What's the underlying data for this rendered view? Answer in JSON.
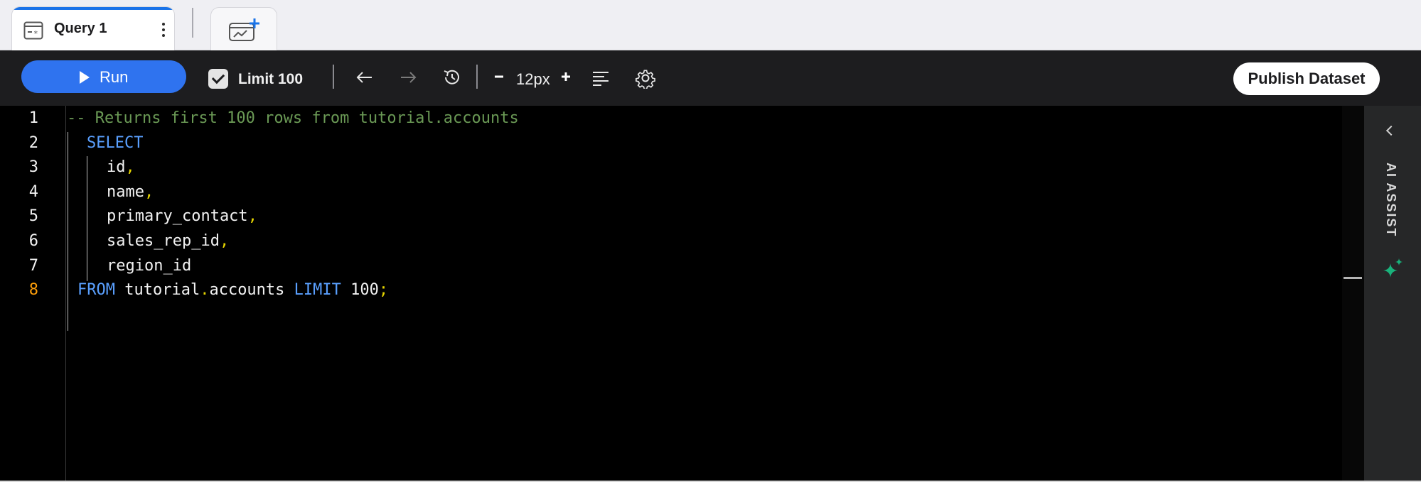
{
  "tabs": {
    "active_label": "Query 1",
    "active_icon": "query-window-icon",
    "new_tab_icon": "new-chart-tab-icon"
  },
  "toolbar": {
    "run_label": "Run",
    "limit_label": "Limit 100",
    "limit_checked": true,
    "font_size": "12px",
    "publish_label": "Publish Dataset",
    "icons": [
      "undo-arrow-icon",
      "redo-arrow-icon",
      "history-icon",
      "minus-icon",
      "plus-icon",
      "format-lines-icon",
      "gear-icon"
    ]
  },
  "editor": {
    "line_numbers": [
      "1",
      "2",
      "3",
      "4",
      "5",
      "6",
      "7",
      "8"
    ],
    "active_line": "8",
    "lines": [
      [
        {
          "t": "-- Returns first 100 rows from tutorial.accounts",
          "k": "comment"
        }
      ],
      [
        {
          "t": "SELECT",
          "k": "kw"
        }
      ],
      [
        {
          "t": "id",
          "k": "id"
        },
        {
          "t": ",",
          "k": "punct"
        }
      ],
      [
        {
          "t": "name",
          "k": "id"
        },
        {
          "t": ",",
          "k": "punct"
        }
      ],
      [
        {
          "t": "primary_contact",
          "k": "id"
        },
        {
          "t": ",",
          "k": "punct"
        }
      ],
      [
        {
          "t": "sales_rep_id",
          "k": "id"
        },
        {
          "t": ",",
          "k": "punct"
        }
      ],
      [
        {
          "t": "region_id",
          "k": "id"
        }
      ],
      [
        {
          "t": "FROM",
          "k": "kw"
        },
        {
          "t": " tutorial",
          "k": "id"
        },
        {
          "t": ".",
          "k": "punct"
        },
        {
          "t": "accounts ",
          "k": "id"
        },
        {
          "t": "LIMIT",
          "k": "kw"
        },
        {
          "t": " 100",
          "k": "id"
        },
        {
          "t": ";",
          "k": "punct"
        }
      ]
    ]
  },
  "ai_panel": {
    "label": "AI ASSIST",
    "icon": "sparkle-icon",
    "collapse_icon": "chevron-left-icon"
  },
  "colors": {
    "run_button": "#2f73ef",
    "toolbar_bg": "#1d1d1f",
    "editor_bg": "#000000",
    "comment": "#6a9955",
    "keyword": "#5aa0ff",
    "punctuation": "#e7d600",
    "active_line_number": "#ff9f0a",
    "sparkle": "#19b27b"
  }
}
